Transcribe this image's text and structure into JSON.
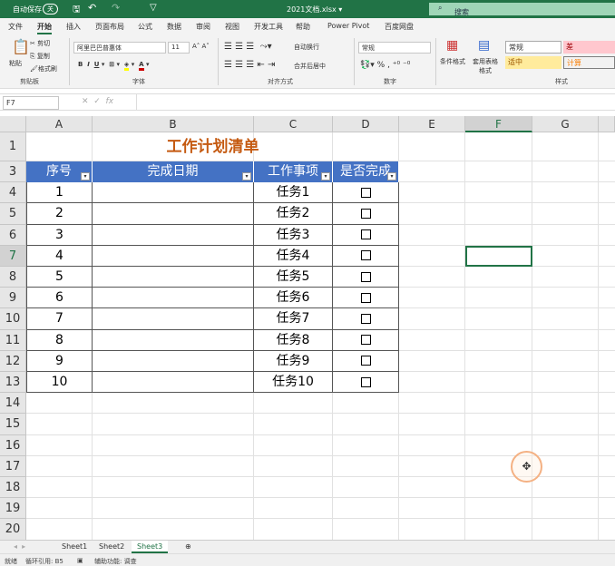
{
  "titlebar": {
    "autosave": "自动保存",
    "autosave_state": "关",
    "filename": "2021文档.xlsx ▾",
    "search": "搜索"
  },
  "menu": [
    "文件",
    "开始",
    "插入",
    "页面布局",
    "公式",
    "数据",
    "审阅",
    "视图",
    "开发工具",
    "帮助",
    "Power Pivot",
    "百度网盘"
  ],
  "ribbon": {
    "paste": "粘贴",
    "cut": "剪切",
    "copy": "复制",
    "format_painter": "格式刷",
    "clipboard": "剪贴板",
    "font_name": "阿里巴巴普惠体",
    "font_size": "11",
    "font_group": "字体",
    "wrap": "自动换行",
    "merge": "合并后居中",
    "align_group": "对齐方式",
    "number_format": "常规",
    "number_group": "数字",
    "cond_format": "条件格式",
    "table_format": "套用表格格式",
    "styles_group": "样式",
    "style_normal": "常规",
    "style_bad": "差",
    "style_neutral": "适中",
    "style_calc": "计算"
  },
  "formula": {
    "namebox": "F7",
    "fx": "fx",
    "value": ""
  },
  "columns": [
    "A",
    "B",
    "C",
    "D",
    "E",
    "F",
    "G"
  ],
  "rows": [
    "1",
    "3",
    "4",
    "5",
    "6",
    "7",
    "8",
    "9",
    "10",
    "11",
    "12",
    "13",
    "14",
    "15",
    "16",
    "17",
    "18",
    "19",
    "20"
  ],
  "sheet": {
    "title": "工作计划清单",
    "headers": [
      "序号",
      "完成日期",
      "工作事项",
      "是否完成"
    ],
    "data": [
      [
        "1",
        "",
        "任务1"
      ],
      [
        "2",
        "",
        "任务2"
      ],
      [
        "3",
        "",
        "任务3"
      ],
      [
        "4",
        "",
        "任务4"
      ],
      [
        "5",
        "",
        "任务5"
      ],
      [
        "6",
        "",
        "任务6"
      ],
      [
        "7",
        "",
        "任务7"
      ],
      [
        "8",
        "",
        "任务8"
      ],
      [
        "9",
        "",
        "任务9"
      ],
      [
        "10",
        "",
        "任务10"
      ]
    ]
  },
  "tabs": [
    "Sheet1",
    "Sheet2",
    "Sheet3"
  ],
  "status": {
    "ready": "就绪",
    "circular": "循环引用: B5",
    "accessibility": "辅助功能: 调查"
  },
  "colors": {
    "brand": "#217346",
    "header": "#4472c4",
    "title": "#c55a11"
  }
}
